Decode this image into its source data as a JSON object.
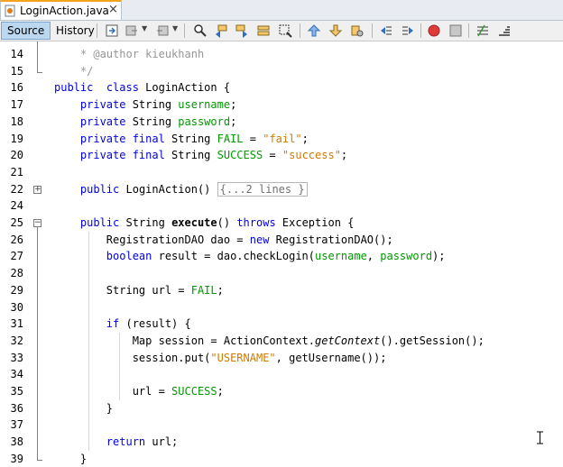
{
  "tab": {
    "title": "LoginAction.java",
    "close": "×",
    "icon": "java-file-icon"
  },
  "toolbar": {
    "source_label": "Source",
    "history_label": "History",
    "icons": [
      "last-edit-icon",
      "back-icon",
      "forward-icon",
      "find-icon",
      "find-previous-icon",
      "find-next-icon",
      "toggle-highlight-icon",
      "find-selection-icon",
      "previous-bookmark-icon",
      "next-bookmark-icon",
      "toggle-bookmark-icon",
      "shift-left-icon",
      "shift-right-icon",
      "start-macro-icon",
      "stop-macro-icon",
      "comment-icon",
      "uncomment-icon"
    ]
  },
  "editor": {
    "lines": [
      {
        "n": "14",
        "tokens": [
          [
            "cm",
            "    * @author kieukhanh"
          ]
        ]
      },
      {
        "n": "15",
        "tokens": [
          [
            "cm",
            "    */"
          ]
        ]
      },
      {
        "n": "16",
        "tokens": [
          [
            "kw",
            "public"
          ],
          [
            "",
            "  "
          ],
          [
            "kw",
            "class"
          ],
          [
            "",
            " LoginAction {"
          ]
        ]
      },
      {
        "n": "17",
        "tokens": [
          [
            "",
            "    "
          ],
          [
            "kw",
            "private"
          ],
          [
            "",
            " String "
          ],
          [
            "fld",
            "username"
          ],
          [
            "",
            ";"
          ]
        ]
      },
      {
        "n": "18",
        "tokens": [
          [
            "",
            "    "
          ],
          [
            "kw",
            "private"
          ],
          [
            "",
            " String "
          ],
          [
            "fld",
            "password"
          ],
          [
            "",
            ";"
          ]
        ]
      },
      {
        "n": "19",
        "tokens": [
          [
            "",
            "    "
          ],
          [
            "kw",
            "private final"
          ],
          [
            "",
            " String "
          ],
          [
            "fld",
            "FAIL"
          ],
          [
            "",
            " = "
          ],
          [
            "str",
            "\"fail\""
          ],
          [
            "",
            ";"
          ]
        ]
      },
      {
        "n": "20",
        "tokens": [
          [
            "",
            "    "
          ],
          [
            "kw",
            "private final"
          ],
          [
            "",
            " String "
          ],
          [
            "fld",
            "SUCCESS"
          ],
          [
            "",
            " = "
          ],
          [
            "str",
            "\"success\""
          ],
          [
            "",
            ";"
          ]
        ]
      },
      {
        "n": "21",
        "tokens": []
      },
      {
        "n": "22",
        "tokens": [
          [
            "",
            "    "
          ],
          [
            "kw",
            "public"
          ],
          [
            "",
            " LoginAction() "
          ],
          [
            "fold-box",
            "{...2 lines }"
          ]
        ]
      },
      {
        "n": "24",
        "tokens": []
      },
      {
        "n": "25",
        "tokens": [
          [
            "",
            "    "
          ],
          [
            "kw",
            "public"
          ],
          [
            "",
            " String "
          ],
          [
            "b",
            "execute"
          ],
          [
            "",
            "() "
          ],
          [
            "kw",
            "throws"
          ],
          [
            "",
            " Exception {"
          ]
        ]
      },
      {
        "n": "26",
        "tokens": [
          [
            "",
            "        RegistrationDAO dao = "
          ],
          [
            "kw",
            "new"
          ],
          [
            "",
            " RegistrationDAO();"
          ]
        ]
      },
      {
        "n": "27",
        "tokens": [
          [
            "",
            "        "
          ],
          [
            "kw",
            "boolean"
          ],
          [
            "",
            " result = dao.checkLogin("
          ],
          [
            "fld",
            "username"
          ],
          [
            "",
            ", "
          ],
          [
            "fld",
            "password"
          ],
          [
            "",
            ");"
          ]
        ]
      },
      {
        "n": "28",
        "tokens": []
      },
      {
        "n": "29",
        "tokens": [
          [
            "",
            "        String url = "
          ],
          [
            "fld",
            "FAIL"
          ],
          [
            "",
            ";"
          ]
        ]
      },
      {
        "n": "30",
        "tokens": []
      },
      {
        "n": "31",
        "tokens": [
          [
            "",
            "        "
          ],
          [
            "kw",
            "if"
          ],
          [
            "",
            " (result) {"
          ]
        ]
      },
      {
        "n": "32",
        "tokens": [
          [
            "",
            "            Map session = ActionContext."
          ],
          [
            "it",
            "getContext"
          ],
          [
            "",
            "().getSession();"
          ]
        ]
      },
      {
        "n": "33",
        "tokens": [
          [
            "",
            "            session.put("
          ],
          [
            "str",
            "\"USERNAME\""
          ],
          [
            "",
            ", getUsername());"
          ]
        ]
      },
      {
        "n": "34",
        "tokens": []
      },
      {
        "n": "35",
        "tokens": [
          [
            "",
            "            url = "
          ],
          [
            "fld",
            "SUCCESS"
          ],
          [
            "",
            ";"
          ]
        ]
      },
      {
        "n": "36",
        "tokens": [
          [
            "",
            "        }"
          ]
        ]
      },
      {
        "n": "37",
        "tokens": []
      },
      {
        "n": "38",
        "tokens": [
          [
            "",
            "        "
          ],
          [
            "kw",
            "return"
          ],
          [
            "",
            " url;"
          ]
        ]
      },
      {
        "n": "39",
        "tokens": [
          [
            "",
            "    }"
          ]
        ]
      }
    ]
  },
  "colors": {
    "keyword": "#0000e6",
    "field": "#009900",
    "string": "#ce7b00",
    "comment": "#969696",
    "tab_accent": "#f4a31c"
  }
}
